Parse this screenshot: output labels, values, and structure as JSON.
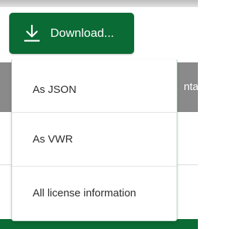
{
  "download_button": {
    "label": "Download...",
    "icon": "download-icon"
  },
  "download_menu": {
    "items": [
      {
        "label": "As JSON"
      },
      {
        "label": "As VWR"
      },
      {
        "label": "All license information"
      }
    ]
  },
  "background": {
    "header_text_fragment": "ntair"
  },
  "colors": {
    "accent": "#0b6b35",
    "header_bg": "#8a8a8a",
    "menu_border": "#b9d6c3"
  }
}
